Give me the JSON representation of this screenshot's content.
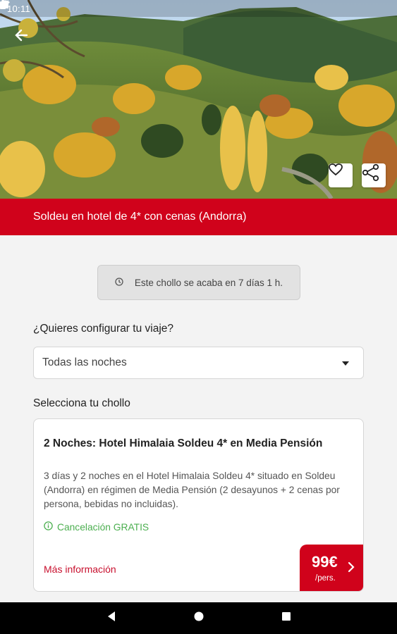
{
  "status_bar": {
    "time": "10:11",
    "icons": [
      "sd-card-icon",
      "wifi-icon",
      "signal-icon",
      "battery-icon"
    ]
  },
  "hero": {
    "image": "autumn-mountain-valley-photo",
    "buttons": [
      "back-arrow-icon",
      "heart-icon",
      "share-icon"
    ]
  },
  "title": "Soldeu en hotel de 4* con cenas (Andorra)",
  "countdown": {
    "icon": "clock-icon",
    "text": "Este chollo se acaba en 7 días 1 h."
  },
  "configure": {
    "label": "¿Quieres configurar tu viaje?",
    "dropdown_value": "Todas las noches"
  },
  "select_label": "Selecciona tu chollo",
  "deal": {
    "title": "2 Noches: Hotel Himalaia Soldeu 4* en Media Pensión",
    "description": "3 días y 2 noches en el Hotel Himalaia Soldeu 4* situado en Soldeu (Andorra) en régimen de Media Pensión (2 desayunos + 2 cenas por persona, bebidas no incluidas).",
    "cancellation": "Cancelación GRATIS",
    "more_info": "Más información",
    "price": "99€",
    "price_unit": "/pers."
  },
  "colors": {
    "brand_red": "#d0021b",
    "green": "#4caf50"
  },
  "nav_bar": [
    "back-triangle-icon",
    "home-circle-icon",
    "recents-square-icon"
  ]
}
